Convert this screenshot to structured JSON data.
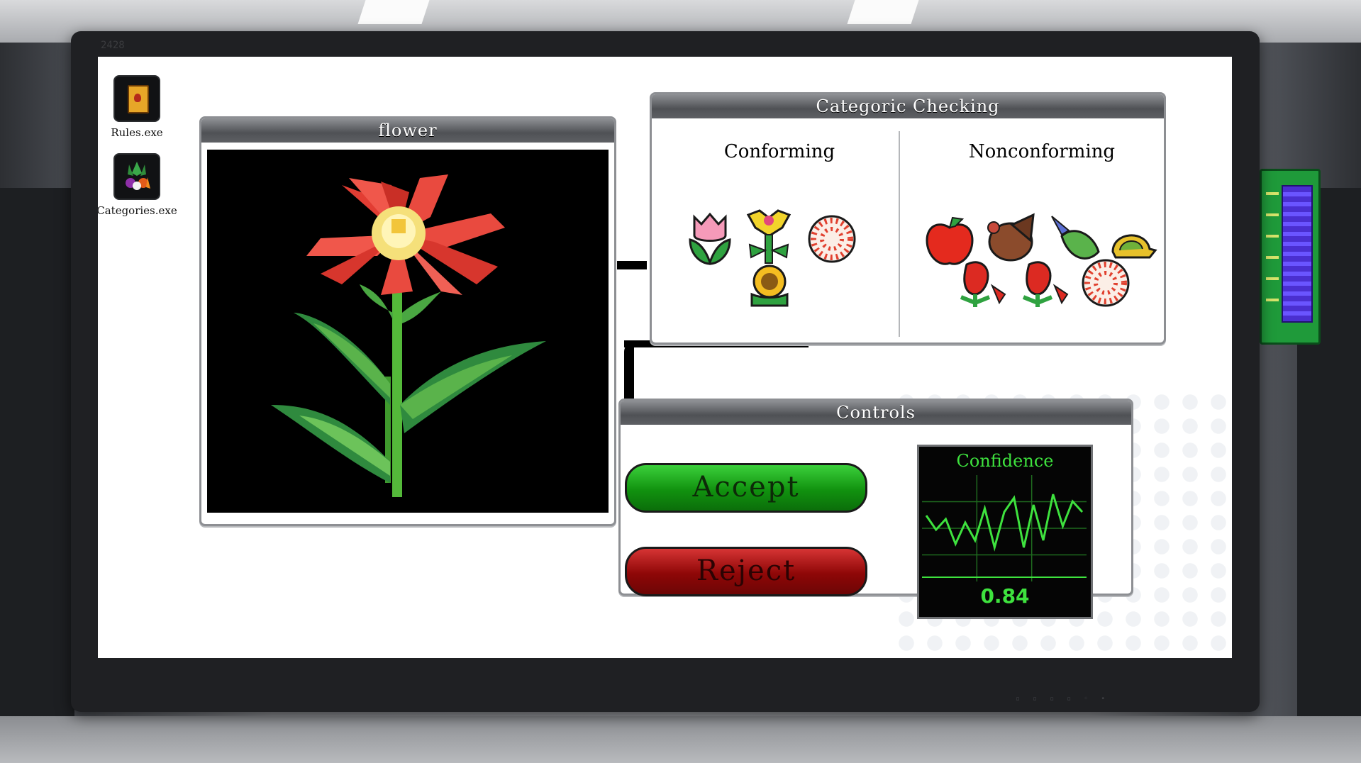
{
  "window": {
    "screen_id": "2428"
  },
  "desktop_icons": [
    {
      "label": "Rules.exe",
      "icon": "rules-book-icon"
    },
    {
      "label": "Categories.exe",
      "icon": "vegetables-icon"
    }
  ],
  "subject_panel": {
    "title": "flower",
    "image": "red-flower-pixel-art"
  },
  "categoric_panel": {
    "title": "Categoric Checking",
    "conforming_label": "Conforming",
    "nonconforming_label": "Nonconforming",
    "conforming_items": [
      "tulip-icon",
      "sunflower-plant-icon",
      "sunflower-icon",
      "dotted-ball-icon"
    ],
    "nonconforming_items": [
      "apple-icon",
      "turkey-icon",
      "leaf-seed-icon",
      "turtle-icon",
      "bell-pepper-plant-icon",
      "bell-pepper-plant-icon",
      "dotted-ball-icon"
    ]
  },
  "controls_panel": {
    "title": "Controls",
    "accept_label": "Accept",
    "reject_label": "Reject",
    "confidence_label": "Confidence",
    "confidence_value": "0.84",
    "confidence_series": [
      0.55,
      0.35,
      0.5,
      0.15,
      0.45,
      0.2,
      0.65,
      0.1,
      0.6,
      0.8,
      0.1,
      0.7,
      0.2,
      0.85,
      0.4,
      0.75,
      0.6
    ]
  },
  "colors": {
    "accept": "#11920f",
    "reject": "#8e0707",
    "graph_line": "#3ee23e"
  }
}
